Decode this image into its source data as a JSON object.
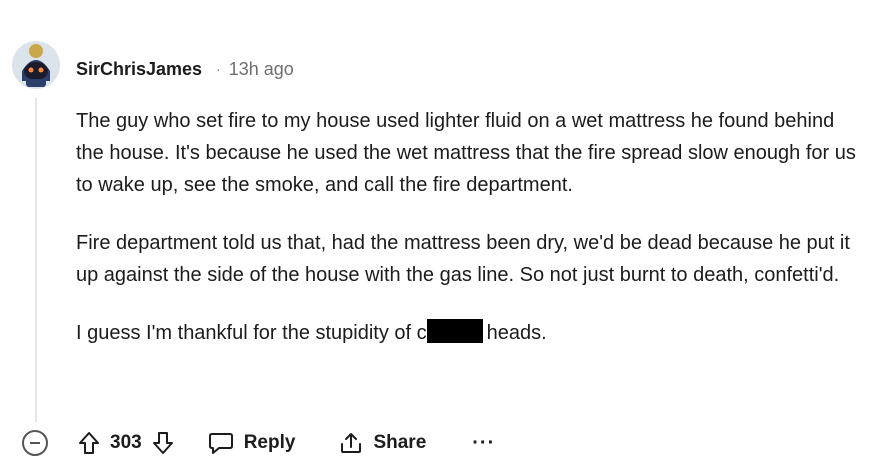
{
  "comment": {
    "author": "SirChrisJames",
    "separator": "·",
    "timestamp": "13h ago",
    "paragraphs": [
      "The guy who set fire to my house used lighter fluid on a wet mattress he found behind the house. It's because he used the wet mattress that the fire spread slow enough for us to wake up, see the smoke, and call the fire department.",
      "Fire department told us that, had the mattress been dry, we'd be dead because he put it up against the side of the house with the gas line. So not just burnt to death, confetti'd."
    ],
    "last_paragraph_before": "I guess I'm thankful for the stupidity of c",
    "last_paragraph_after": "heads."
  },
  "actions": {
    "score": "303",
    "reply_label": "Reply",
    "share_label": "Share",
    "more_label": "···"
  },
  "icons": {
    "collapse": "collapse-minus-icon",
    "upvote": "upvote-arrow-icon",
    "downvote": "downvote-arrow-icon",
    "reply": "speech-bubble-icon",
    "share": "share-arrow-icon",
    "avatar": "robot-avatar-icon"
  }
}
